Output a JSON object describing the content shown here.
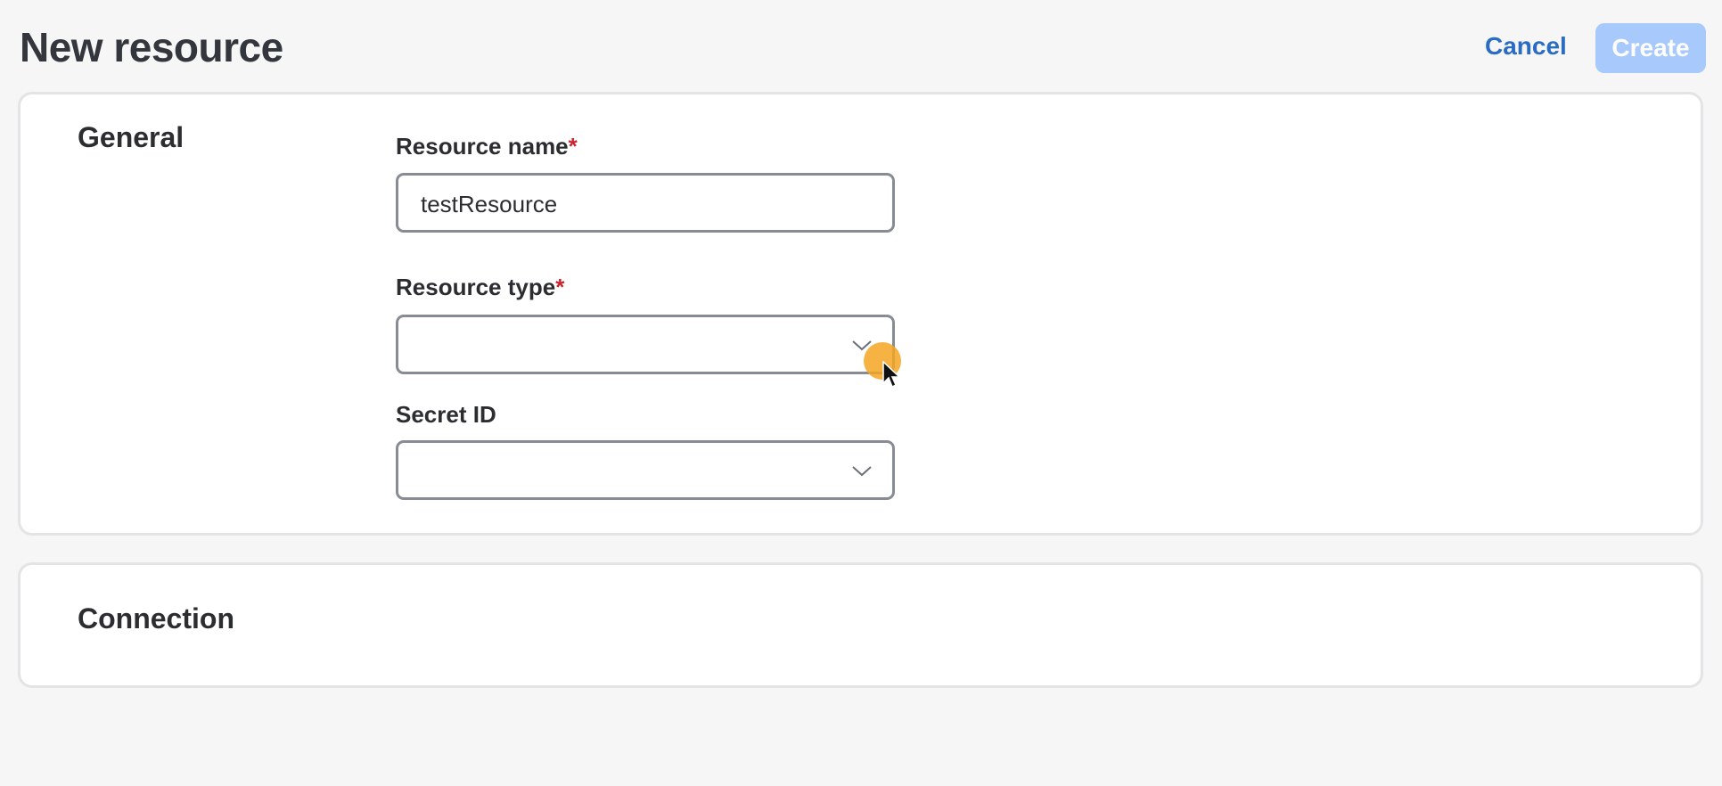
{
  "header": {
    "title": "New resource",
    "cancel_label": "Cancel",
    "create_label": "Create"
  },
  "general": {
    "heading": "General",
    "resource_name": {
      "label": "Resource name",
      "required_mark": "*",
      "value": "testResource"
    },
    "resource_type": {
      "label": "Resource type",
      "required_mark": "*",
      "value": ""
    },
    "secret_id": {
      "label": "Secret ID",
      "value": ""
    }
  },
  "connection": {
    "heading": "Connection"
  },
  "colors": {
    "accent": "#2a6bc4",
    "create_disabled": "#a7c9fb",
    "required": "#c8252f",
    "cursor_highlight": "#f5a623"
  }
}
